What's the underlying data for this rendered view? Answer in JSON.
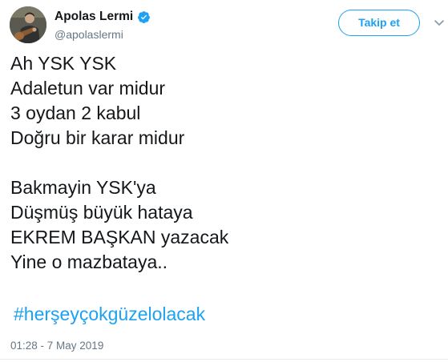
{
  "user": {
    "display_name": "Apolas Lermi",
    "handle": "@apolaslermi",
    "verified": true
  },
  "follow_button": {
    "label": "Takip et"
  },
  "tweet": {
    "lines": [
      "Ah YSK YSK",
      "Adaletun var midur",
      "3 oydan 2 kabul",
      "Doğru bir karar midur",
      "",
      "Bakmayin YSK'ya",
      "Düşmüş büyük hataya",
      "EKREM BAŞKAN yazacak",
      "Yine o mazbataya.."
    ],
    "hashtag": "#herşeyçokgüzelolacak",
    "timestamp": "01:28 - 7 May 2019"
  },
  "icons": {
    "verified": "verified-badge-icon",
    "menu": "chevron-down-icon",
    "avatar": "avatar"
  },
  "colors": {
    "accent": "#1da1f2",
    "text": "#14171a",
    "muted": "#657786"
  }
}
